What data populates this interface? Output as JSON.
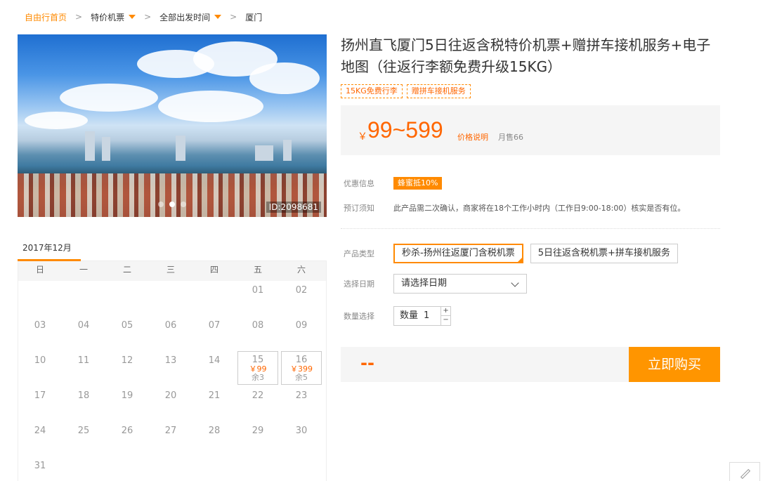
{
  "breadcrumb": {
    "home": "自由行首页",
    "sep": ">",
    "item1": "特价机票",
    "item2": "全部出发时间",
    "current": "厦门"
  },
  "photo": {
    "id_label": "ID:2098681",
    "slides": 3,
    "active_slide": 1
  },
  "calendar": {
    "month": "2017年12月",
    "weekdays": [
      "日",
      "一",
      "二",
      "三",
      "四",
      "五",
      "六"
    ],
    "rows": [
      [
        {
          "d": ""
        },
        {
          "d": ""
        },
        {
          "d": ""
        },
        {
          "d": ""
        },
        {
          "d": ""
        },
        {
          "d": "01"
        },
        {
          "d": "02"
        }
      ],
      [
        {
          "d": "03"
        },
        {
          "d": "04"
        },
        {
          "d": "05"
        },
        {
          "d": "06"
        },
        {
          "d": "07"
        },
        {
          "d": "08"
        },
        {
          "d": "09"
        }
      ],
      [
        {
          "d": "10"
        },
        {
          "d": "11"
        },
        {
          "d": "12"
        },
        {
          "d": "13"
        },
        {
          "d": "14"
        },
        {
          "d": "15",
          "price": "￥99",
          "left": "余3"
        },
        {
          "d": "16",
          "price": "￥399",
          "left": "余5"
        }
      ],
      [
        {
          "d": "17"
        },
        {
          "d": "18"
        },
        {
          "d": "19"
        },
        {
          "d": "20"
        },
        {
          "d": "21"
        },
        {
          "d": "22"
        },
        {
          "d": "23"
        }
      ],
      [
        {
          "d": "24"
        },
        {
          "d": "25"
        },
        {
          "d": "26"
        },
        {
          "d": "27"
        },
        {
          "d": "28"
        },
        {
          "d": "29"
        },
        {
          "d": "30"
        }
      ],
      [
        {
          "d": "31"
        },
        {
          "d": ""
        },
        {
          "d": ""
        },
        {
          "d": ""
        },
        {
          "d": ""
        },
        {
          "d": ""
        },
        {
          "d": ""
        }
      ]
    ]
  },
  "product": {
    "title": "扬州直飞厦门5日往返含税特价机票+赠拼车接机服务+电子地图（往返行李额免费升级15KG）",
    "tags": [
      "15KG免费行李",
      "赠拼车接机服务"
    ],
    "price_symbol": "￥",
    "price_range": "99~599",
    "price_explain": "价格说明",
    "monthly_sales": "月售66"
  },
  "info": {
    "discount_label": "优惠信息",
    "discount_badge": "蜂蜜抵10%",
    "notice_label": "预订须知",
    "notice_text": "此产品需二次确认，商家将在18个工作小时内（工作日9:00-18:00）核实是否有位。"
  },
  "options": {
    "type_label": "产品类型",
    "types": [
      "秒杀-扬州往返厦门含税机票",
      "5日往返含税机票+拼车接机服务"
    ],
    "selected_type": 0,
    "date_label": "选择日期",
    "date_placeholder": "请选择日期",
    "qty_label": "数量选择",
    "qty_prefix": "数量",
    "qty_value": "1",
    "qty_plus": "+",
    "qty_minus": "−"
  },
  "buy": {
    "total": "--",
    "button": "立即购买"
  },
  "colors": {
    "accent": "#ff8a00",
    "price": "#ff6600"
  }
}
